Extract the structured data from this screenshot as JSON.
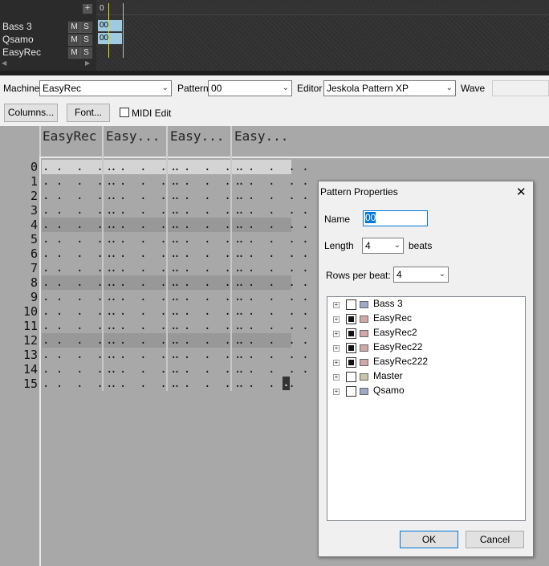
{
  "sequencer": {
    "add_label": "+",
    "time_marker": "0",
    "tracks": [
      {
        "name": "Bass 3",
        "mute": "M",
        "solo": "S",
        "pattern": "00"
      },
      {
        "name": "Qsamo",
        "mute": "M",
        "solo": "S",
        "pattern": "00"
      },
      {
        "name": "EasyRec",
        "mute": "M",
        "solo": "S",
        "pattern": ""
      }
    ],
    "scroll_left": "◀",
    "scroll_right": "▶"
  },
  "toolbar": {
    "machine_label": "Machine",
    "machine_value": "EasyRec",
    "pattern_label": "Pattern",
    "pattern_value": "00",
    "editor_label": "Editor",
    "editor_value": "Jeskola Pattern XP",
    "wave_label": "Wave",
    "wave_value": ""
  },
  "toolbar2": {
    "columns_button": "Columns...",
    "font_button": "Font...",
    "midi_edit_label": "MIDI Edit",
    "midi_edit_checked": false
  },
  "pattern_editor": {
    "columns": [
      "EasyRec",
      "Easy...",
      "Easy...",
      "Easy..."
    ],
    "rows": [
      "0",
      "1",
      "2",
      "3",
      "4",
      "5",
      "6",
      "7",
      "8",
      "9",
      "10",
      "11",
      "12",
      "13",
      "14",
      "15"
    ],
    "cell_text": ". .  .  . .",
    "last_cell_text": ". .  .  .",
    "cursor_char": "."
  },
  "dialog": {
    "title": "Pattern Properties",
    "close": "✕",
    "name_label": "Name",
    "name_value": "00",
    "length_label": "Length",
    "length_value": "4",
    "length_unit": "beats",
    "rpb_label": "Rows per beat:",
    "rpb_value": "4",
    "machines": [
      {
        "name": "Bass 3",
        "checked": false,
        "color": "#a0a8c8"
      },
      {
        "name": "EasyRec",
        "checked": true,
        "color": "#d0a8a8"
      },
      {
        "name": "EasyRec2",
        "checked": true,
        "color": "#d0a8a8"
      },
      {
        "name": "EasyRec22",
        "checked": true,
        "color": "#d0a8a8"
      },
      {
        "name": "EasyRec222",
        "checked": true,
        "color": "#d0a8a8"
      },
      {
        "name": "Master",
        "checked": false,
        "color": "#c8c8a8"
      },
      {
        "name": "Qsamo",
        "checked": false,
        "color": "#a0a8c8"
      }
    ],
    "ok_button": "OK",
    "cancel_button": "Cancel"
  }
}
